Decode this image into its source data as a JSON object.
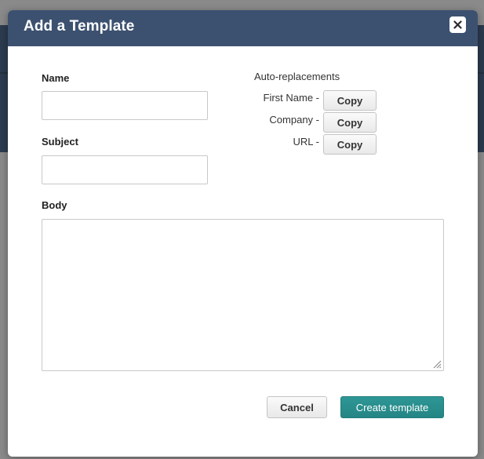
{
  "dialog": {
    "title": "Add a Template"
  },
  "form": {
    "name_label": "Name",
    "name_value": "",
    "subject_label": "Subject",
    "subject_value": "",
    "body_label": "Body",
    "body_value": ""
  },
  "auto_replacements": {
    "heading": "Auto-replacements",
    "items": [
      {
        "label": "First Name -",
        "button": "Copy"
      },
      {
        "label": "Company -",
        "button": "Copy"
      },
      {
        "label": "URL -",
        "button": "Copy"
      }
    ]
  },
  "actions": {
    "cancel_label": "Cancel",
    "create_label": "Create template"
  },
  "colors": {
    "header": "#3c5170",
    "primary_button": "#2a908f",
    "backdrop": "#8a8a8a"
  },
  "icons": {
    "close": "close-icon",
    "resize": "resize-grip-icon"
  }
}
